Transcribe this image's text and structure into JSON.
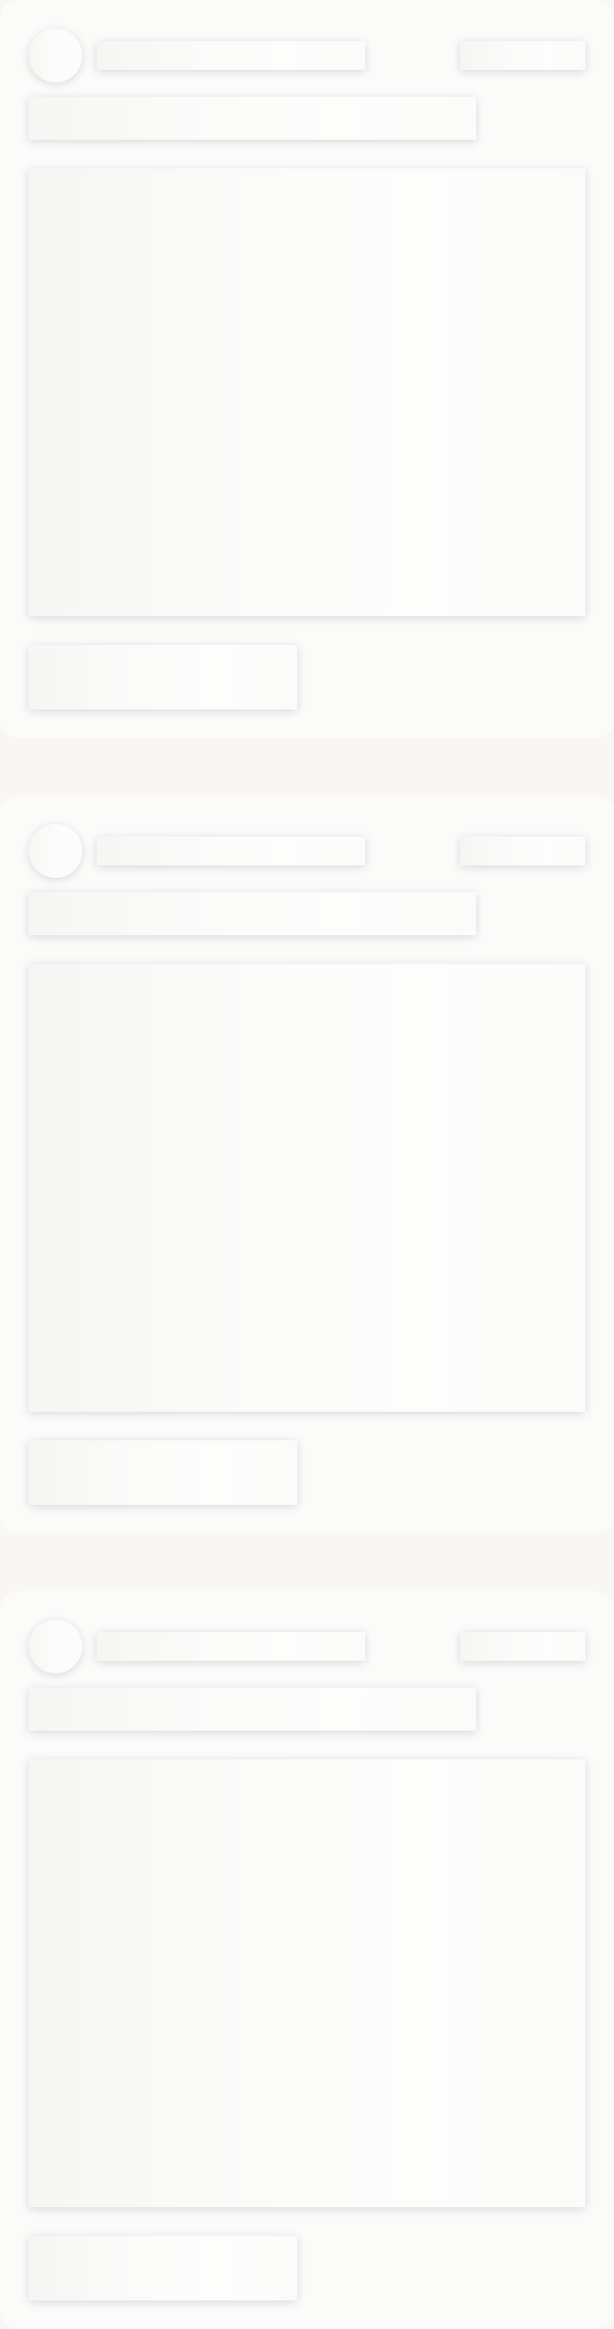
{
  "screen": {
    "state": "loading-skeleton",
    "background_color": "#f9f6f4",
    "card_color": "#fbfbfa"
  },
  "feed": {
    "cards": [
      {
        "placeholder_parts": [
          "avatar",
          "author-name",
          "meta-tag",
          "title-line",
          "media",
          "action-button"
        ]
      },
      {
        "placeholder_parts": [
          "avatar",
          "author-name",
          "meta-tag",
          "title-line",
          "media",
          "action-button"
        ]
      },
      {
        "placeholder_parts": [
          "avatar",
          "author-name",
          "meta-tag",
          "title-line",
          "media",
          "action-button"
        ]
      }
    ]
  }
}
